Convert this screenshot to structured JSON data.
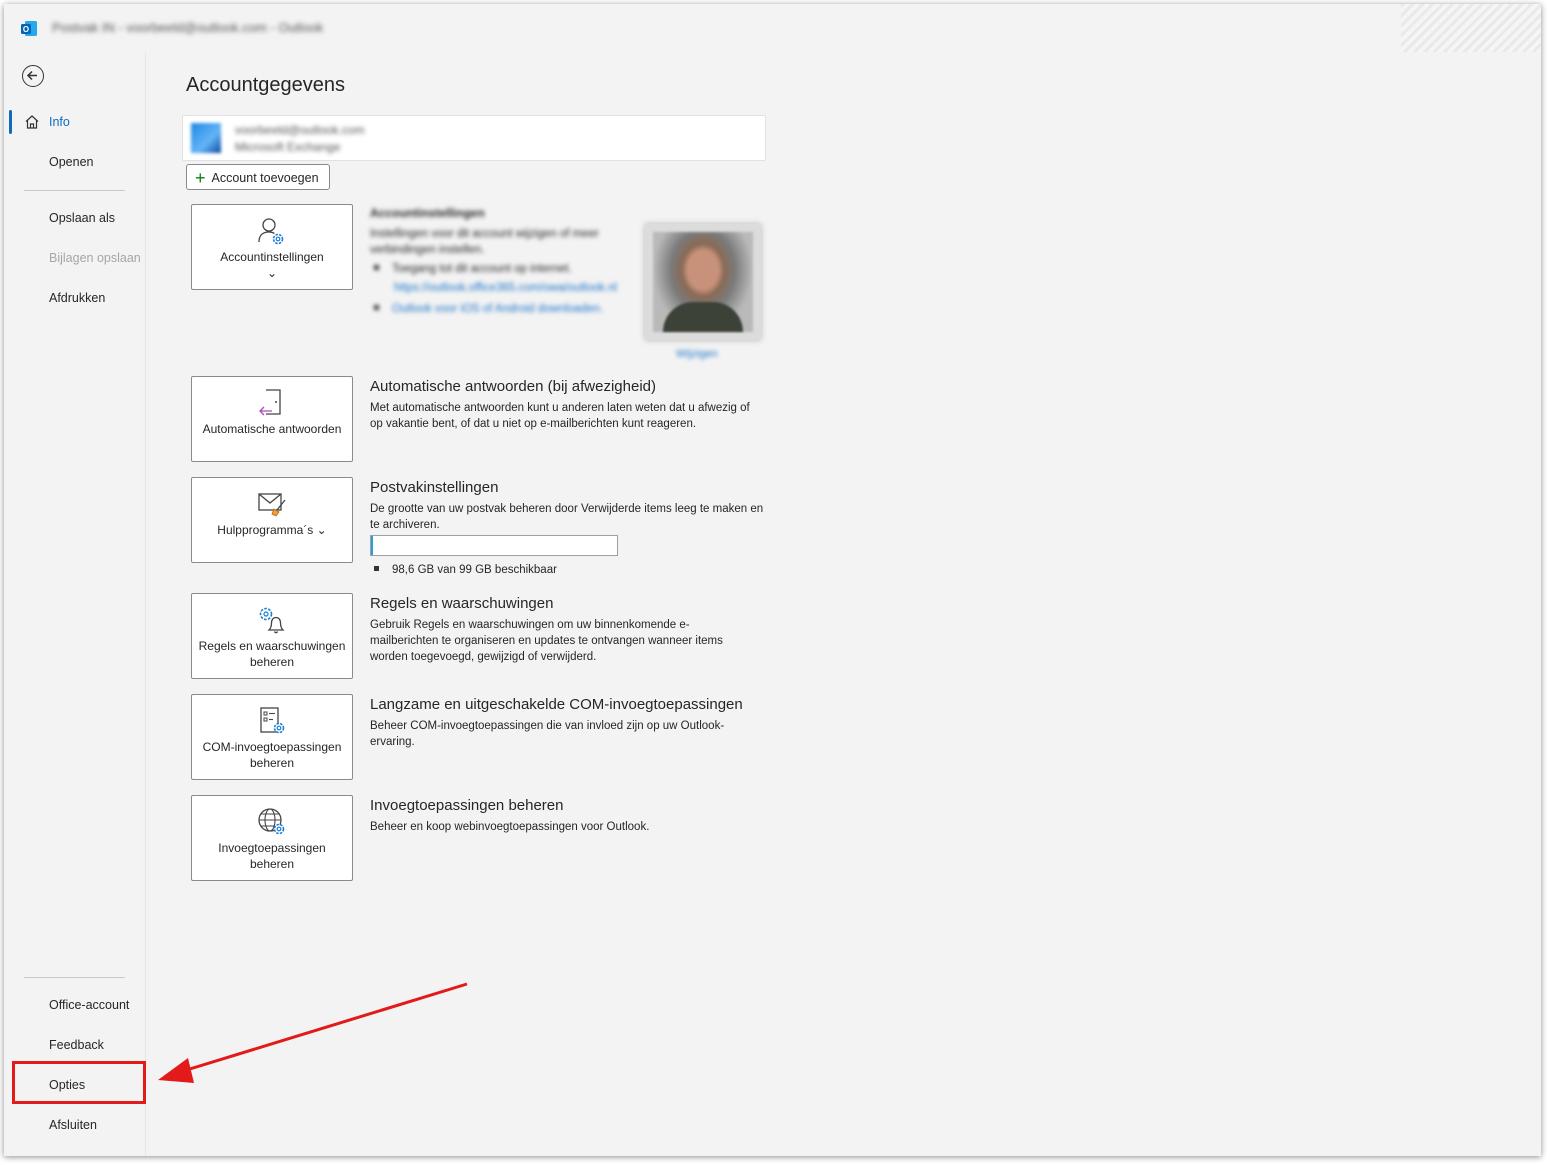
{
  "window": {
    "title": "Postvak IN - voorbeeld@outlook.com - Outlook"
  },
  "nav": {
    "back_label": "",
    "items": [
      {
        "label": "Info"
      },
      {
        "label": "Openen"
      },
      {
        "label": "Opslaan als"
      },
      {
        "label": "Bijlagen opslaan"
      },
      {
        "label": "Afdrukken"
      },
      {
        "label": "Office-account"
      },
      {
        "label": "Feedback"
      },
      {
        "label": "Opties"
      },
      {
        "label": "Afsluiten"
      }
    ]
  },
  "main": {
    "page_title": "Accountgegevens",
    "account": {
      "line1": "voorbeeld@outlook.com",
      "line2": "Microsoft Exchange"
    },
    "add_account_label": "Account toevoegen",
    "account_settings": {
      "tile_label": "Accountinstellingen",
      "chevron": "⌄",
      "title": "Accountinstellingen",
      "desc": "Instellingen voor dit account wijzigen of meer verbindingen instellen.",
      "bullet1": "Toegang tot dit account op internet.",
      "link1": "https://outlook.office365.com/owa/outlook.nl",
      "bullet2": "Outlook voor iOS of Android downloaden.",
      "photo_link": "Wijzigen"
    },
    "auto_reply": {
      "tile_label": "Automatische antwoorden",
      "title": "Automatische antwoorden (bij afwezigheid)",
      "desc": "Met automatische antwoorden kunt u anderen laten weten dat u afwezig of op vakantie bent, of dat u niet op e-mailberichten kunt reageren."
    },
    "mailbox": {
      "tile_label": "Hulpprogramma´s",
      "chevron": "⌄",
      "title": "Postvakinstellingen",
      "desc": "De grootte van uw postvak beheren door Verwijderde items leeg te maken en te archiveren.",
      "quota_used_fraction": 0.01,
      "quota_text": "98,6 GB van 99 GB beschikbaar"
    },
    "rules": {
      "tile_label": "Regels en waarschuwingen beheren",
      "title": "Regels en waarschuwingen",
      "desc": "Gebruik Regels en waarschuwingen om uw binnenkomende e-mailberichten te organiseren en updates te ontvangen wanneer items worden toegevoegd, gewijzigd of verwijderd."
    },
    "com_addins": {
      "tile_label": "COM-invoegtoepassingen beheren",
      "title": "Langzame en uitgeschakelde COM-invoegtoepassingen",
      "desc": "Beheer COM-invoegtoepassingen die van invloed zijn op uw Outlook-ervaring."
    },
    "addins": {
      "tile_label": "Invoegtoepassingen beheren",
      "title": "Invoegtoepassingen beheren",
      "desc": "Beheer en koop webinvoegtoepassingen voor Outlook."
    }
  },
  "colors": {
    "accent": "#0f6cbd",
    "highlight": "#e21a1a",
    "quota": "#2a9fd6"
  }
}
